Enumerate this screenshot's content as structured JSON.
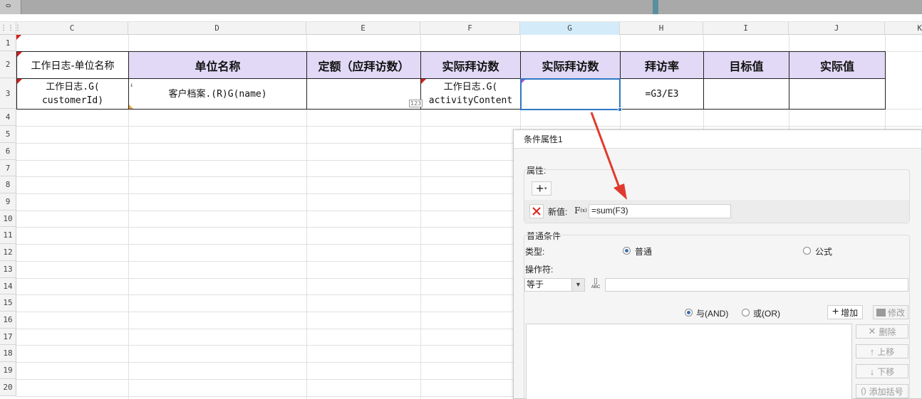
{
  "window": {
    "corner_label": "0"
  },
  "columns": [
    {
      "id": "C",
      "label": "C"
    },
    {
      "id": "D",
      "label": "D"
    },
    {
      "id": "E",
      "label": "E"
    },
    {
      "id": "F",
      "label": "F"
    },
    {
      "id": "G",
      "label": "G",
      "selected": true
    },
    {
      "id": "H",
      "label": "H"
    },
    {
      "id": "I",
      "label": "I"
    },
    {
      "id": "J",
      "label": "J"
    },
    {
      "id": "K",
      "label": "K"
    }
  ],
  "rows": [
    "1",
    "2",
    "3",
    "4",
    "5",
    "6",
    "7",
    "8",
    "9",
    "10",
    "11",
    "12",
    "13",
    "14",
    "15",
    "16",
    "17",
    "18",
    "19",
    "20"
  ],
  "sheet": {
    "header_row": {
      "c": "工作日志-单位名称",
      "d": "单位名称",
      "e": "定额（应拜访数）",
      "f": "实际拜访数",
      "g": "实际拜访数",
      "h": "拜访率",
      "i": "目标值",
      "j": "实际值"
    },
    "data_row": {
      "c_line1": "工作日志.G(",
      "c_line2": "customerId)",
      "d": "客户档案.(R)G(name)",
      "e": "",
      "f_line1": "工作日志.G(",
      "f_line2": "activityContent",
      "f_tag": "123",
      "g": "",
      "h": "=G3/E3",
      "i": "",
      "j": ""
    }
  },
  "colors": {
    "header_fill": "#e1d9f5",
    "selection": "#2f78c4",
    "arrow": "#e03a2e"
  },
  "dialog": {
    "title": "条件属性1",
    "attributes_label": "属性:",
    "new_value_label": "新值:",
    "new_value_formula": "=sum(F3)",
    "normal_condition_label": "普通条件",
    "type_label": "类型:",
    "type_normal": "普通",
    "type_formula": "公式",
    "type_selected": "普通",
    "operator_label": "操作符:",
    "operator_value": "等于",
    "and_label": "与(AND)",
    "or_label": "或(OR)",
    "logic_selected": "与(AND)",
    "add_button": "增加",
    "modify_button": "修改",
    "delete_button": "删除",
    "move_up_button": "上移",
    "move_down_button": "下移",
    "add_bracket_button": "添加括号"
  }
}
